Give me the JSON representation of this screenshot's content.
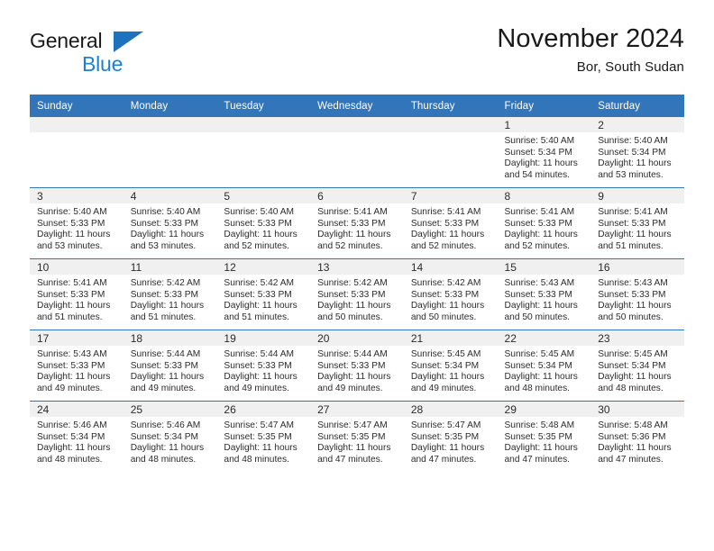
{
  "brand": {
    "name_part1": "General",
    "name_part2": "Blue",
    "flag_icon": "triangle-flag-icon"
  },
  "header": {
    "title": "November 2024",
    "subtitle": "Bor, South Sudan"
  },
  "calendar": {
    "weekday_headers": [
      "Sunday",
      "Monday",
      "Tuesday",
      "Wednesday",
      "Thursday",
      "Friday",
      "Saturday"
    ],
    "colors": {
      "header_blue": "#3275b8",
      "daynum_strip": "#f0f0f0",
      "brand_blue": "#1c7fd4",
      "text": "#2b2b2b"
    },
    "weeks": [
      [
        {
          "day": "",
          "lines": []
        },
        {
          "day": "",
          "lines": []
        },
        {
          "day": "",
          "lines": []
        },
        {
          "day": "",
          "lines": []
        },
        {
          "day": "",
          "lines": []
        },
        {
          "day": "1",
          "lines": [
            "Sunrise: 5:40 AM",
            "Sunset: 5:34 PM",
            "Daylight: 11 hours and 54 minutes."
          ]
        },
        {
          "day": "2",
          "lines": [
            "Sunrise: 5:40 AM",
            "Sunset: 5:34 PM",
            "Daylight: 11 hours and 53 minutes."
          ]
        }
      ],
      [
        {
          "day": "3",
          "lines": [
            "Sunrise: 5:40 AM",
            "Sunset: 5:33 PM",
            "Daylight: 11 hours and 53 minutes."
          ]
        },
        {
          "day": "4",
          "lines": [
            "Sunrise: 5:40 AM",
            "Sunset: 5:33 PM",
            "Daylight: 11 hours and 53 minutes."
          ]
        },
        {
          "day": "5",
          "lines": [
            "Sunrise: 5:40 AM",
            "Sunset: 5:33 PM",
            "Daylight: 11 hours and 52 minutes."
          ]
        },
        {
          "day": "6",
          "lines": [
            "Sunrise: 5:41 AM",
            "Sunset: 5:33 PM",
            "Daylight: 11 hours and 52 minutes."
          ]
        },
        {
          "day": "7",
          "lines": [
            "Sunrise: 5:41 AM",
            "Sunset: 5:33 PM",
            "Daylight: 11 hours and 52 minutes."
          ]
        },
        {
          "day": "8",
          "lines": [
            "Sunrise: 5:41 AM",
            "Sunset: 5:33 PM",
            "Daylight: 11 hours and 52 minutes."
          ]
        },
        {
          "day": "9",
          "lines": [
            "Sunrise: 5:41 AM",
            "Sunset: 5:33 PM",
            "Daylight: 11 hours and 51 minutes."
          ]
        }
      ],
      [
        {
          "day": "10",
          "lines": [
            "Sunrise: 5:41 AM",
            "Sunset: 5:33 PM",
            "Daylight: 11 hours and 51 minutes."
          ]
        },
        {
          "day": "11",
          "lines": [
            "Sunrise: 5:42 AM",
            "Sunset: 5:33 PM",
            "Daylight: 11 hours and 51 minutes."
          ]
        },
        {
          "day": "12",
          "lines": [
            "Sunrise: 5:42 AM",
            "Sunset: 5:33 PM",
            "Daylight: 11 hours and 51 minutes."
          ]
        },
        {
          "day": "13",
          "lines": [
            "Sunrise: 5:42 AM",
            "Sunset: 5:33 PM",
            "Daylight: 11 hours and 50 minutes."
          ]
        },
        {
          "day": "14",
          "lines": [
            "Sunrise: 5:42 AM",
            "Sunset: 5:33 PM",
            "Daylight: 11 hours and 50 minutes."
          ]
        },
        {
          "day": "15",
          "lines": [
            "Sunrise: 5:43 AM",
            "Sunset: 5:33 PM",
            "Daylight: 11 hours and 50 minutes."
          ]
        },
        {
          "day": "16",
          "lines": [
            "Sunrise: 5:43 AM",
            "Sunset: 5:33 PM",
            "Daylight: 11 hours and 50 minutes."
          ]
        }
      ],
      [
        {
          "day": "17",
          "lines": [
            "Sunrise: 5:43 AM",
            "Sunset: 5:33 PM",
            "Daylight: 11 hours and 49 minutes."
          ]
        },
        {
          "day": "18",
          "lines": [
            "Sunrise: 5:44 AM",
            "Sunset: 5:33 PM",
            "Daylight: 11 hours and 49 minutes."
          ]
        },
        {
          "day": "19",
          "lines": [
            "Sunrise: 5:44 AM",
            "Sunset: 5:33 PM",
            "Daylight: 11 hours and 49 minutes."
          ]
        },
        {
          "day": "20",
          "lines": [
            "Sunrise: 5:44 AM",
            "Sunset: 5:33 PM",
            "Daylight: 11 hours and 49 minutes."
          ]
        },
        {
          "day": "21",
          "lines": [
            "Sunrise: 5:45 AM",
            "Sunset: 5:34 PM",
            "Daylight: 11 hours and 49 minutes."
          ]
        },
        {
          "day": "22",
          "lines": [
            "Sunrise: 5:45 AM",
            "Sunset: 5:34 PM",
            "Daylight: 11 hours and 48 minutes."
          ]
        },
        {
          "day": "23",
          "lines": [
            "Sunrise: 5:45 AM",
            "Sunset: 5:34 PM",
            "Daylight: 11 hours and 48 minutes."
          ]
        }
      ],
      [
        {
          "day": "24",
          "lines": [
            "Sunrise: 5:46 AM",
            "Sunset: 5:34 PM",
            "Daylight: 11 hours and 48 minutes."
          ]
        },
        {
          "day": "25",
          "lines": [
            "Sunrise: 5:46 AM",
            "Sunset: 5:34 PM",
            "Daylight: 11 hours and 48 minutes."
          ]
        },
        {
          "day": "26",
          "lines": [
            "Sunrise: 5:47 AM",
            "Sunset: 5:35 PM",
            "Daylight: 11 hours and 48 minutes."
          ]
        },
        {
          "day": "27",
          "lines": [
            "Sunrise: 5:47 AM",
            "Sunset: 5:35 PM",
            "Daylight: 11 hours and 47 minutes."
          ]
        },
        {
          "day": "28",
          "lines": [
            "Sunrise: 5:47 AM",
            "Sunset: 5:35 PM",
            "Daylight: 11 hours and 47 minutes."
          ]
        },
        {
          "day": "29",
          "lines": [
            "Sunrise: 5:48 AM",
            "Sunset: 5:35 PM",
            "Daylight: 11 hours and 47 minutes."
          ]
        },
        {
          "day": "30",
          "lines": [
            "Sunrise: 5:48 AM",
            "Sunset: 5:36 PM",
            "Daylight: 11 hours and 47 minutes."
          ]
        }
      ]
    ]
  }
}
